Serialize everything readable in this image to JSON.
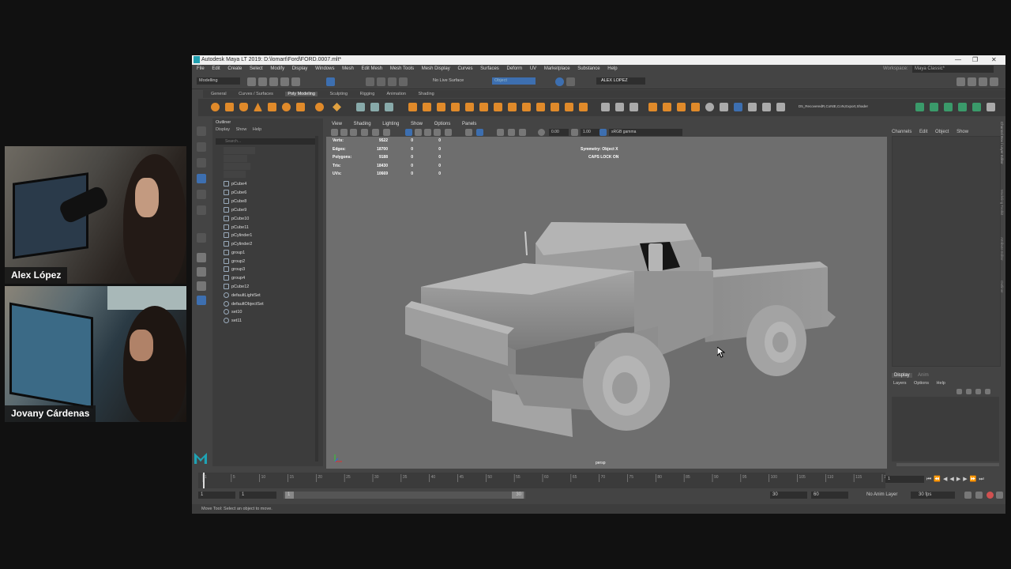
{
  "webcams": [
    {
      "name": "Alex López"
    },
    {
      "name": "Jovany Cárdenas"
    }
  ],
  "window": {
    "title": "Autodesk Maya LT 2019: D:\\lomart\\Ford\\FORD.0007.mlt*",
    "controls": [
      "—",
      "❐",
      "✕"
    ]
  },
  "menubar": {
    "items": [
      "File",
      "Edit",
      "Create",
      "Select",
      "Modify",
      "Display",
      "Windows",
      "Mesh",
      "Edit Mesh",
      "Mesh Tools",
      "Mesh Display",
      "Curves",
      "Surfaces",
      "Deform",
      "UV",
      "Marketplace",
      "Substance",
      "Help"
    ],
    "workspace_label": "Workspace:",
    "workspace_value": "Maya Classic*"
  },
  "statusline": {
    "mode": "Modelling",
    "live_surface": "No Live Surface",
    "object_field": "Object",
    "user": "ALEX LOPEZ"
  },
  "shelf_tabs": {
    "items": [
      "General",
      "Curves / Surfaces",
      "Poly Modeling",
      "Sculpting",
      "Rigging",
      "Animation",
      "Shading"
    ],
    "active": "Poly Modeling"
  },
  "shelf_path": "D5_RecoveredR,CoNtE,CoN,Export,Shader",
  "outliner": {
    "title": "Outliner",
    "menu": [
      "Display",
      "Show",
      "Help"
    ],
    "search_placeholder": "Search...",
    "items": [
      "pCube4",
      "pCube6",
      "pCube8",
      "pCube9",
      "pCube10",
      "pCube11",
      "pCylinder1",
      "pCylinder2",
      "group1",
      "group2",
      "group3",
      "group4",
      "pCube12",
      "defaultLightSet",
      "defaultObjectSet",
      "set10",
      "set11"
    ]
  },
  "viewport": {
    "menu": [
      "View",
      "Shading",
      "Lighting",
      "Show",
      "Options",
      "Panels"
    ],
    "exposure": "0.00",
    "gamma": "1.00",
    "color_space": "sRGB gamma",
    "camera": "persp",
    "stats": [
      {
        "label": "Verts:",
        "v1": "9522",
        "v2": "0",
        "v3": "0"
      },
      {
        "label": "Edges:",
        "v1": "18700",
        "v2": "0",
        "v3": "0"
      },
      {
        "label": "Polygons:",
        "v1": "9188",
        "v2": "0",
        "v3": "0"
      },
      {
        "label": "Tris:",
        "v1": "18430",
        "v2": "0",
        "v3": "0"
      },
      {
        "label": "UVs:",
        "v1": "10669",
        "v2": "0",
        "v3": "0"
      }
    ],
    "symmetry": "Symmetry: Object X",
    "caps_lock": "CAPS LOCK ON"
  },
  "channel_box": {
    "menu": [
      "Channels",
      "Edit",
      "Object",
      "Show"
    ],
    "side_tabs": [
      "Channel Box / Layer Editor",
      "Modeling Toolkit",
      "Attribute Editor",
      "Outliner"
    ]
  },
  "layer_editor": {
    "tabs": [
      "Display",
      "Anim"
    ],
    "menu": [
      "Layers",
      "Options",
      "Help"
    ]
  },
  "timeline": {
    "ticks": [
      "1",
      "5",
      "10",
      "15",
      "20",
      "25",
      "30",
      "35",
      "40",
      "45",
      "50",
      "55",
      "60",
      "65",
      "70",
      "75",
      "80",
      "85",
      "90",
      "95",
      "100",
      "105",
      "110",
      "115",
      "120"
    ],
    "current_frame": "1"
  },
  "range": {
    "start": "1",
    "anim_start": "1",
    "range_start_label": "1",
    "range_end_label": "30",
    "anim_end": "30",
    "end": "60",
    "anim_layer": "No Anim Layer",
    "fps": "30 fps"
  },
  "help_line": "Move Tool: Select an object to move."
}
